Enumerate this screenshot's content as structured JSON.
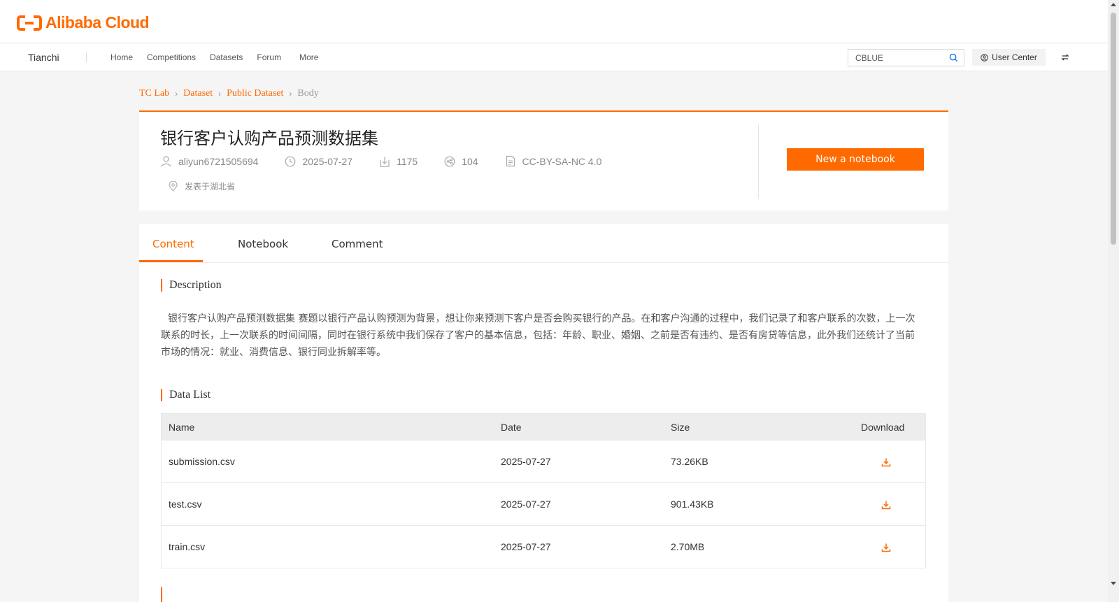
{
  "brand": {
    "logo_text": "Alibaba Cloud",
    "accent_color": "#ff6a00"
  },
  "nav": {
    "site_name": "Tianchi",
    "links": [
      "Home",
      "Competitions",
      "Datasets",
      "Forum",
      "More"
    ],
    "search_value": "CBLUE",
    "user_center_label": "User Center"
  },
  "breadcrumb": [
    "TC Lab",
    "Dataset",
    "Public Dataset",
    "Body"
  ],
  "dataset": {
    "title": "银行客户认购产品预测数据集",
    "author": "aliyun6721505694",
    "date": "2025-07-27",
    "downloads": "1175",
    "shares": "104",
    "license": "CC-BY-SA-NC 4.0",
    "location": "发表于湖北省",
    "notebook_button": "New a notebook"
  },
  "tabs": [
    "Content",
    "Notebook",
    "Comment"
  ],
  "content": {
    "description_title": "Description",
    "description_text": "银行客户认购产品预测数据集 赛题以银行产品认购预测为背景，想让你来预测下客户是否会购买银行的产品。在和客户沟通的过程中，我们记录了和客户联系的次数，上一次联系的时长，上一次联系的时间间隔，同时在银行系统中我们保存了客户的基本信息，包括：年龄、职业、婚姻、之前是否有违约、是否有房贷等信息，此外我们还统计了当前市场的情况：就业、消费信息、银行同业拆解率等。",
    "data_list_title": "Data List",
    "table": {
      "headers": [
        "Name",
        "Date",
        "Size",
        "Download"
      ],
      "rows": [
        {
          "name": "submission.csv",
          "date": "2025-07-27",
          "size": "73.26KB"
        },
        {
          "name": "test.csv",
          "date": "2025-07-27",
          "size": "901.43KB"
        },
        {
          "name": "train.csv",
          "date": "2025-07-27",
          "size": "2.70MB"
        }
      ]
    }
  }
}
